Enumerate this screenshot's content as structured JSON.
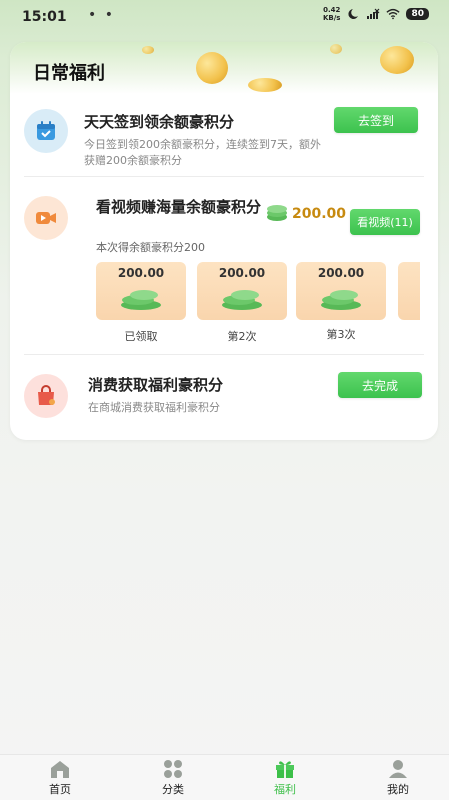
{
  "status_bar": {
    "time": "15:01",
    "dots": "• •",
    "net_speed_value": "0.42",
    "net_speed_unit": "KB/s",
    "battery": "80"
  },
  "card": {
    "title": "日常福利"
  },
  "tasks": {
    "signin": {
      "title": "天天签到领余额豪积分",
      "desc": "今日签到领200余额豪积分，连续签到7天，额外获赠200余额豪积分",
      "button": "去签到",
      "icon": "calendar-check-icon"
    },
    "video": {
      "title": "看视频赚海量余额豪积分",
      "amount": "200.00",
      "button": "看视频(11)",
      "desc": "本次得余额豪积分200",
      "icon": "video-icon",
      "rewards": [
        {
          "amount": "200.00",
          "label": "已领取"
        },
        {
          "amount": "200.00",
          "label": "第2次"
        },
        {
          "amount": "200.00",
          "label": "第3次"
        }
      ]
    },
    "shopping": {
      "title": "消费获取福利豪积分",
      "desc": "在商城消费获取福利豪积分",
      "button": "去完成",
      "icon": "shopping-bag-icon"
    }
  },
  "nav": {
    "items": [
      {
        "label": "首页",
        "icon": "home-icon"
      },
      {
        "label": "分类",
        "icon": "category-icon"
      },
      {
        "label": "福利",
        "icon": "gift-icon",
        "active": true
      },
      {
        "label": "我的",
        "icon": "profile-icon"
      }
    ]
  },
  "colors": {
    "accent": "#3cc24e",
    "amount_gold": "#c78a10",
    "reward_bg": "#fbdcb8"
  }
}
